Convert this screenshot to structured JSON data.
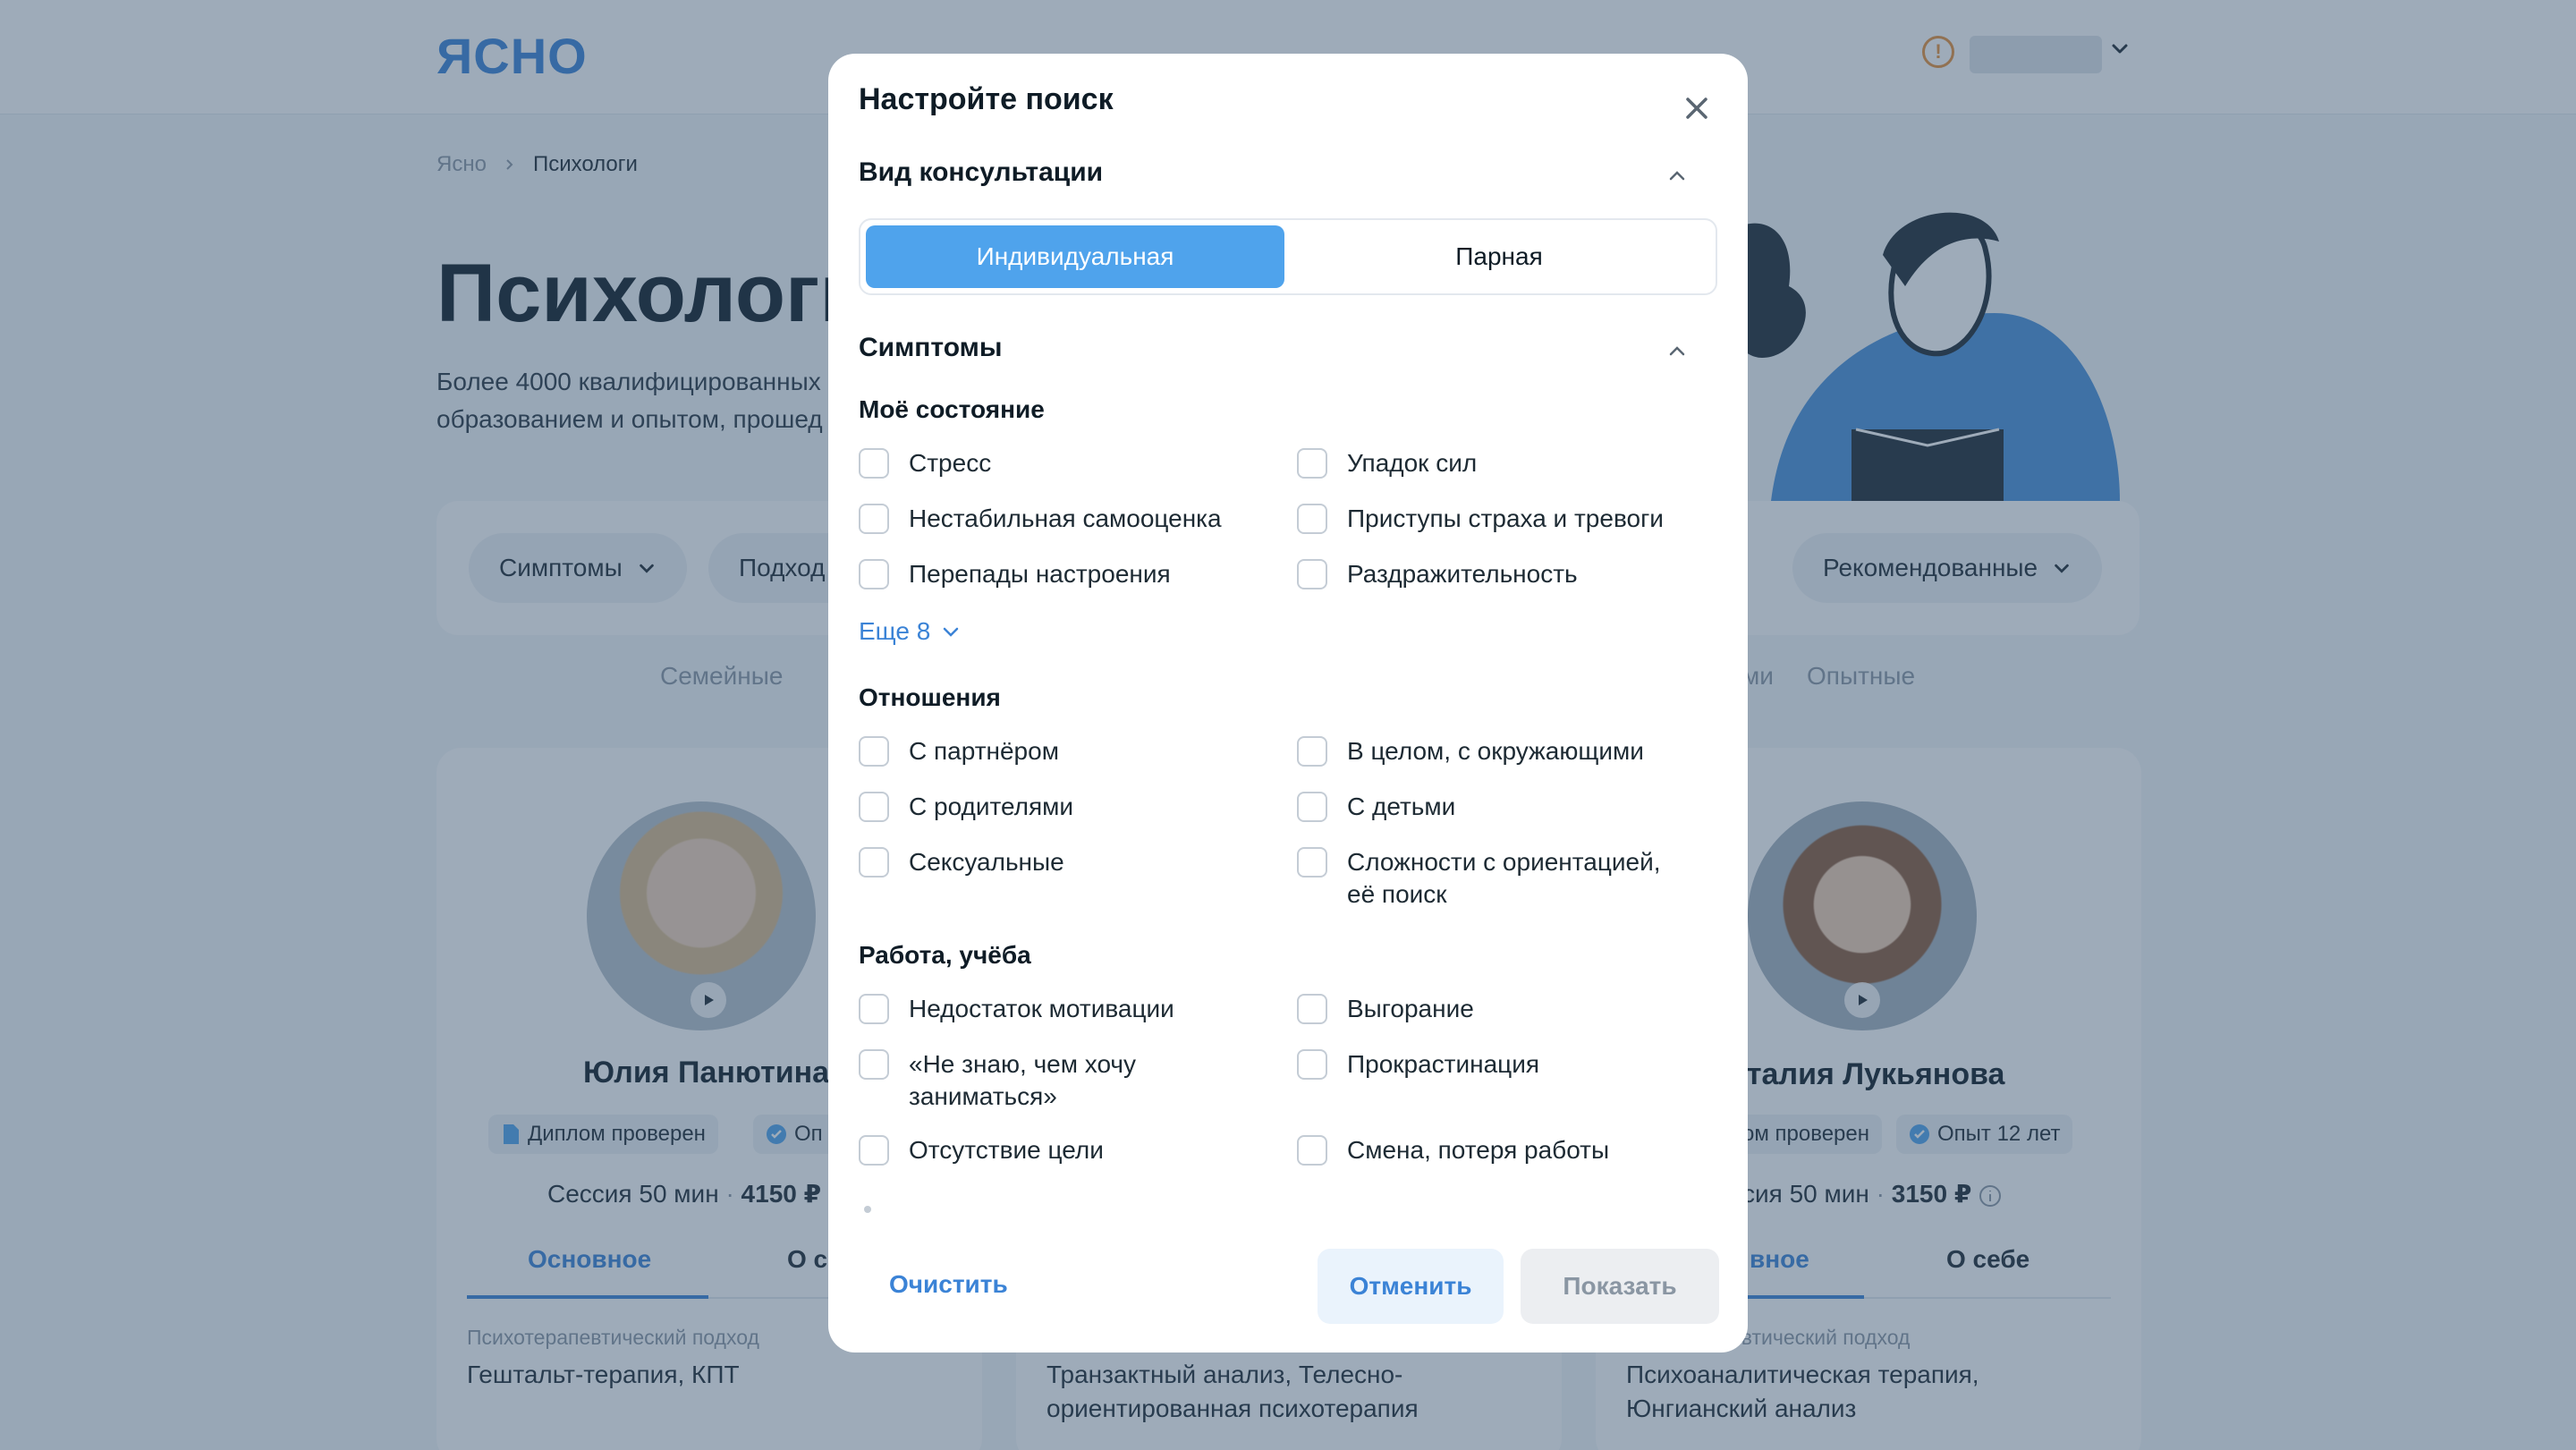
{
  "app": {
    "logo": "ЯСНО"
  },
  "breadcrumb": {
    "home": "Ясно",
    "current": "Психологи"
  },
  "hero": {
    "title": "Психологи",
    "subtitle": "Более 4000 квалифицированных образованием и опытом, прошед"
  },
  "filters": {
    "chip_symptoms": "Симптомы",
    "chip_approach": "Подход",
    "chip_sort": "Рекомендованные"
  },
  "tags": {
    "family": "Семейные",
    "partial_right": "ми",
    "experienced": "Опытные"
  },
  "cards": [
    {
      "name": "Юлия Панютина",
      "badge_diploma": "Диплом проверен",
      "badge_exp_partial": "Оп",
      "session": "Сессия 50 мин",
      "price": "4150 ₽",
      "tab_main": "Основное",
      "tab_about_partial": "О с",
      "approach_label": "Психотерапевтический подход",
      "approach_value": "Гештальт-терапия, КПТ"
    },
    {
      "approach_value_line1": "Транзактный анализ, Телесно-",
      "approach_value_line2": "ориентированная психотерапия"
    },
    {
      "name_partial": "аталия Лукьянова",
      "badge_diploma_partial": "ом проверен",
      "badge_exp": "Опыт 12 лет",
      "session_partial": "ссия 50 мин",
      "price": "3150 ₽",
      "tab_main_partial": "вное",
      "tab_about": "О себе",
      "approach_label_partial": "евтический подход",
      "approach_value_line1": "Психоаналитическая терапия,",
      "approach_value_line2": "Юнгианский анализ"
    }
  ],
  "modal": {
    "title": "Настройте поиск",
    "consultation": {
      "heading": "Вид консультации",
      "options": [
        "Индивидуальная",
        "Парная"
      ],
      "selected": "Индивидуальная"
    },
    "symptoms": {
      "heading": "Симптомы",
      "groups": [
        {
          "title": "Моё состояние",
          "items": [
            "Стресс",
            "Упадок сил",
            "Нестабильная самооценка",
            "Приступы страха и тревоги",
            "Перепады настроения",
            "Раздражительность"
          ],
          "more": "Еще 8"
        },
        {
          "title": "Отношения",
          "items": [
            "С партнёром",
            "В целом, с окружающими",
            "С родителями",
            "С детьми",
            "Сексуальные",
            "Сложности с ориентацией, её поиск"
          ]
        },
        {
          "title": "Работа, учёба",
          "items": [
            "Недостаток мотивации",
            "Выгорание",
            "«Не знаю, чем хочу заниматься»",
            "Прокрастинация",
            "Отсутствие цели",
            "Смена, потеря работы"
          ]
        }
      ]
    },
    "footer": {
      "clear": "Очистить",
      "cancel": "Отменить",
      "show": "Показать"
    }
  },
  "colors": {
    "accent": "#3b83d6",
    "segment_active": "#4fa3ec",
    "overlay": "#34506c"
  },
  "icons": [
    "alert-icon",
    "chevron-down-icon",
    "close-icon",
    "chevron-up-icon",
    "play-icon",
    "document-icon",
    "verified-icon",
    "info-icon"
  ]
}
